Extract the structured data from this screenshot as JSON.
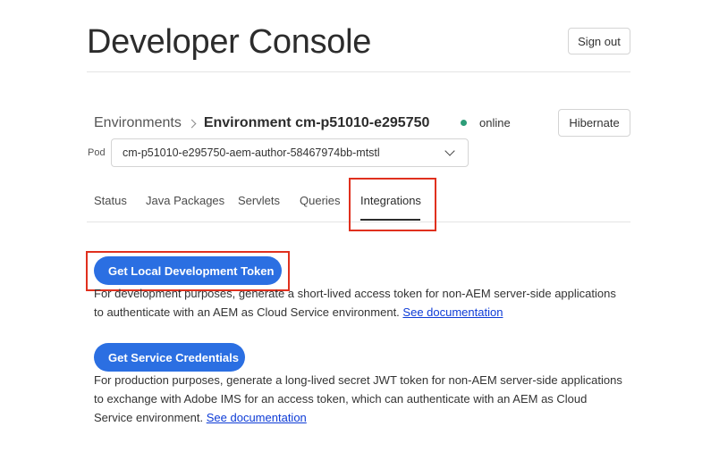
{
  "header": {
    "title": "Developer Console",
    "sign_out_label": "Sign out"
  },
  "breadcrumb": {
    "root": "Environments",
    "current": "Environment cm-p51010-e295750"
  },
  "environment": {
    "status_text": "online",
    "status_color": "#2d9d78",
    "hibernate_label": "Hibernate"
  },
  "pod": {
    "label": "Pod",
    "selected": "cm-p51010-e295750-aem-author-58467974bb-mtstl"
  },
  "tabs": [
    {
      "label": "Status"
    },
    {
      "label": "Java Packages"
    },
    {
      "label": "Servlets"
    },
    {
      "label": "Queries"
    },
    {
      "label": "Integrations",
      "active": true
    }
  ],
  "integrations": {
    "token": {
      "button_label": "Get Local Development Token",
      "desc_line1": "For development purposes, generate a short-lived access token for non-AEM server-side applications",
      "desc_line2": "to authenticate with an AEM as Cloud Service environment.",
      "link_label": "See documentation"
    },
    "credentials": {
      "button_label": "Get Service Credentials",
      "desc_line1": "For production purposes, generate a long-lived secret JWT token for non-AEM server-side applications",
      "desc_line2": "to exchange with Adobe IMS for an access token, which can authenticate with an AEM as Cloud",
      "desc_line3": "Service environment.",
      "link_label": "See documentation"
    }
  },
  "colors": {
    "primary_button": "#2b6fe2",
    "highlight": "#e0301e",
    "link": "#0d3bd6"
  }
}
